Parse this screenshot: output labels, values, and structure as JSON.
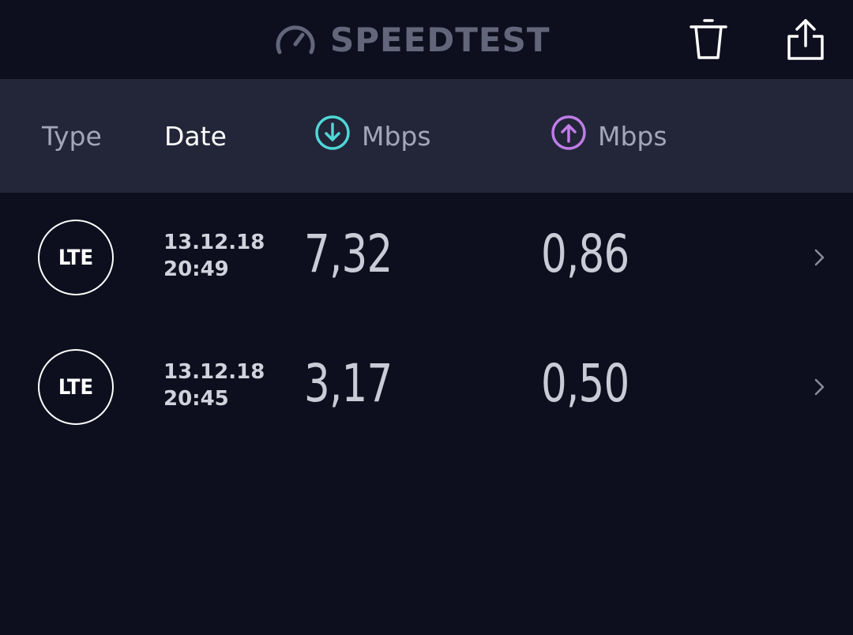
{
  "app": {
    "title": "SPEEDTEST"
  },
  "colors": {
    "background": "#0e0f1e",
    "header_background": "#222638",
    "download_accent": "#4fd6d6",
    "upload_accent": "#c07ce8",
    "muted_text": "#a3a6b7"
  },
  "header": {
    "type_label": "Type",
    "date_label": "Date",
    "download_label": "Mbps",
    "upload_label": "Mbps"
  },
  "results": [
    {
      "type": "LTE",
      "date": "13.12.18",
      "time": "20:49",
      "download": "7,32",
      "upload": "0,86"
    },
    {
      "type": "LTE",
      "date": "13.12.18",
      "time": "20:45",
      "download": "3,17",
      "upload": "0,50"
    }
  ],
  "icons": {
    "brand": "speedometer-icon",
    "delete": "trash-icon",
    "share": "share-icon",
    "download": "download-arrow-icon",
    "upload": "upload-arrow-icon",
    "row_detail": "chevron-right-icon"
  }
}
